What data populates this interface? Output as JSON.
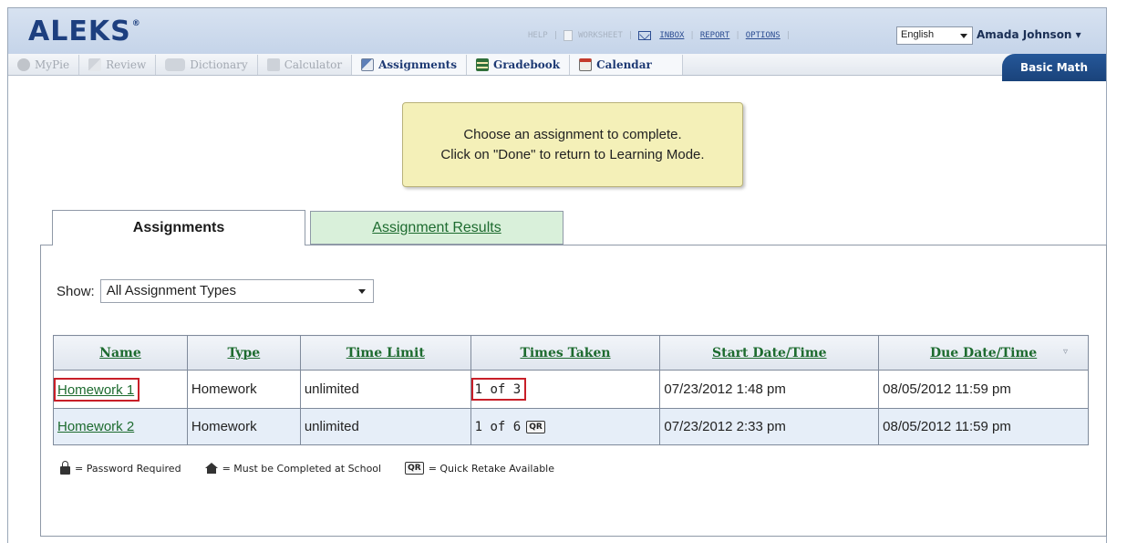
{
  "app": {
    "logo": "ALEKS",
    "logo_mark": "®",
    "links": {
      "help": "HELP",
      "worksheet": "WORKSHEET",
      "inbox": "INBOX",
      "report": "REPORT",
      "options": "OPTIONS"
    },
    "language": "English",
    "user": "Amada Johnson ▾",
    "course": "Basic Math"
  },
  "toolbar": {
    "items": [
      {
        "label": "MyPie",
        "icon": "pie-icon",
        "active": false
      },
      {
        "label": "Review",
        "icon": "review-icon",
        "active": false
      },
      {
        "label": "Dictionary",
        "icon": "dictionary-icon",
        "active": false
      },
      {
        "label": "Calculator",
        "icon": "calculator-icon",
        "active": false
      },
      {
        "label": "Assignments",
        "icon": "assignments-icon",
        "active": true
      },
      {
        "label": "Gradebook",
        "icon": "gradebook-icon",
        "active": true
      },
      {
        "label": "Calendar",
        "icon": "calendar-icon",
        "active": true
      }
    ]
  },
  "tooltip": {
    "line1": "Choose an assignment to complete.",
    "line2": "Click on \"Done\" to return to Learning Mode."
  },
  "tabs": {
    "assignments": "Assignments",
    "results": "Assignment Results"
  },
  "filter": {
    "label": "Show:",
    "value": "All Assignment Types"
  },
  "table": {
    "headers": [
      "Name",
      "Type",
      "Time Limit",
      "Times Taken",
      "Start Date/Time",
      "Due Date/Time"
    ],
    "sort_icon": "sort-icon",
    "rows": [
      {
        "name": "Homework 1",
        "type": "Homework",
        "time_limit": "unlimited",
        "times_taken": "1 of 3",
        "quick_retake": "",
        "start": "07/23/2012  1:48 pm",
        "due": "08/05/2012  11:59 pm"
      },
      {
        "name": "Homework 2",
        "type": "Homework",
        "time_limit": "unlimited",
        "times_taken": "1 of 6",
        "quick_retake": "QR",
        "start": "07/23/2012  2:33 pm",
        "due": "08/05/2012  11:59 pm"
      }
    ]
  },
  "legend": {
    "password": "= Password Required",
    "school": "= Must be Completed at School",
    "qr_badge": "QR",
    "quick_retake": "= Quick Retake Available"
  },
  "colors": {
    "logo": "#1d3f7f",
    "course_tab": "#1f4b8a",
    "tooltip_bg": "#f4f0b8",
    "results_tab": "#d9f0da",
    "link_green": "#1d6b2f",
    "highlight_red": "#c81f28"
  }
}
